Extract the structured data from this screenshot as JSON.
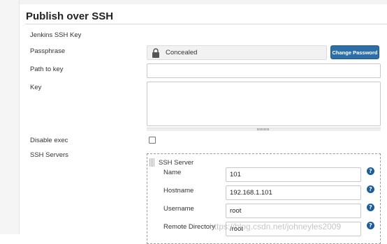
{
  "section": {
    "title": "Publish over SSH"
  },
  "jenkins_ssh_key": {
    "label": "Jenkins SSH Key"
  },
  "passphrase": {
    "label": "Passphrase",
    "value": "Concealed",
    "change_button": "Change Password"
  },
  "path_to_key": {
    "label": "Path to key",
    "value": ""
  },
  "key": {
    "label": "Key",
    "value": ""
  },
  "disable_exec": {
    "label": "Disable exec",
    "checked": false
  },
  "ssh_servers": {
    "label": "SSH Servers",
    "server": {
      "header": "SSH Server",
      "name_label": "Name",
      "name_value": "101",
      "hostname_label": "Hostname",
      "hostname_value": "192.168.1.101",
      "username_label": "Username",
      "username_value": "root",
      "remote_dir_label": "Remote Directory",
      "remote_dir_value": "/root"
    }
  },
  "help_glyph": "?",
  "watermark": "https://blog.csdn.net/johneyles2009",
  "colors": {
    "button_bg": "#2c6fa8",
    "help_icon": "#1c5d99"
  }
}
